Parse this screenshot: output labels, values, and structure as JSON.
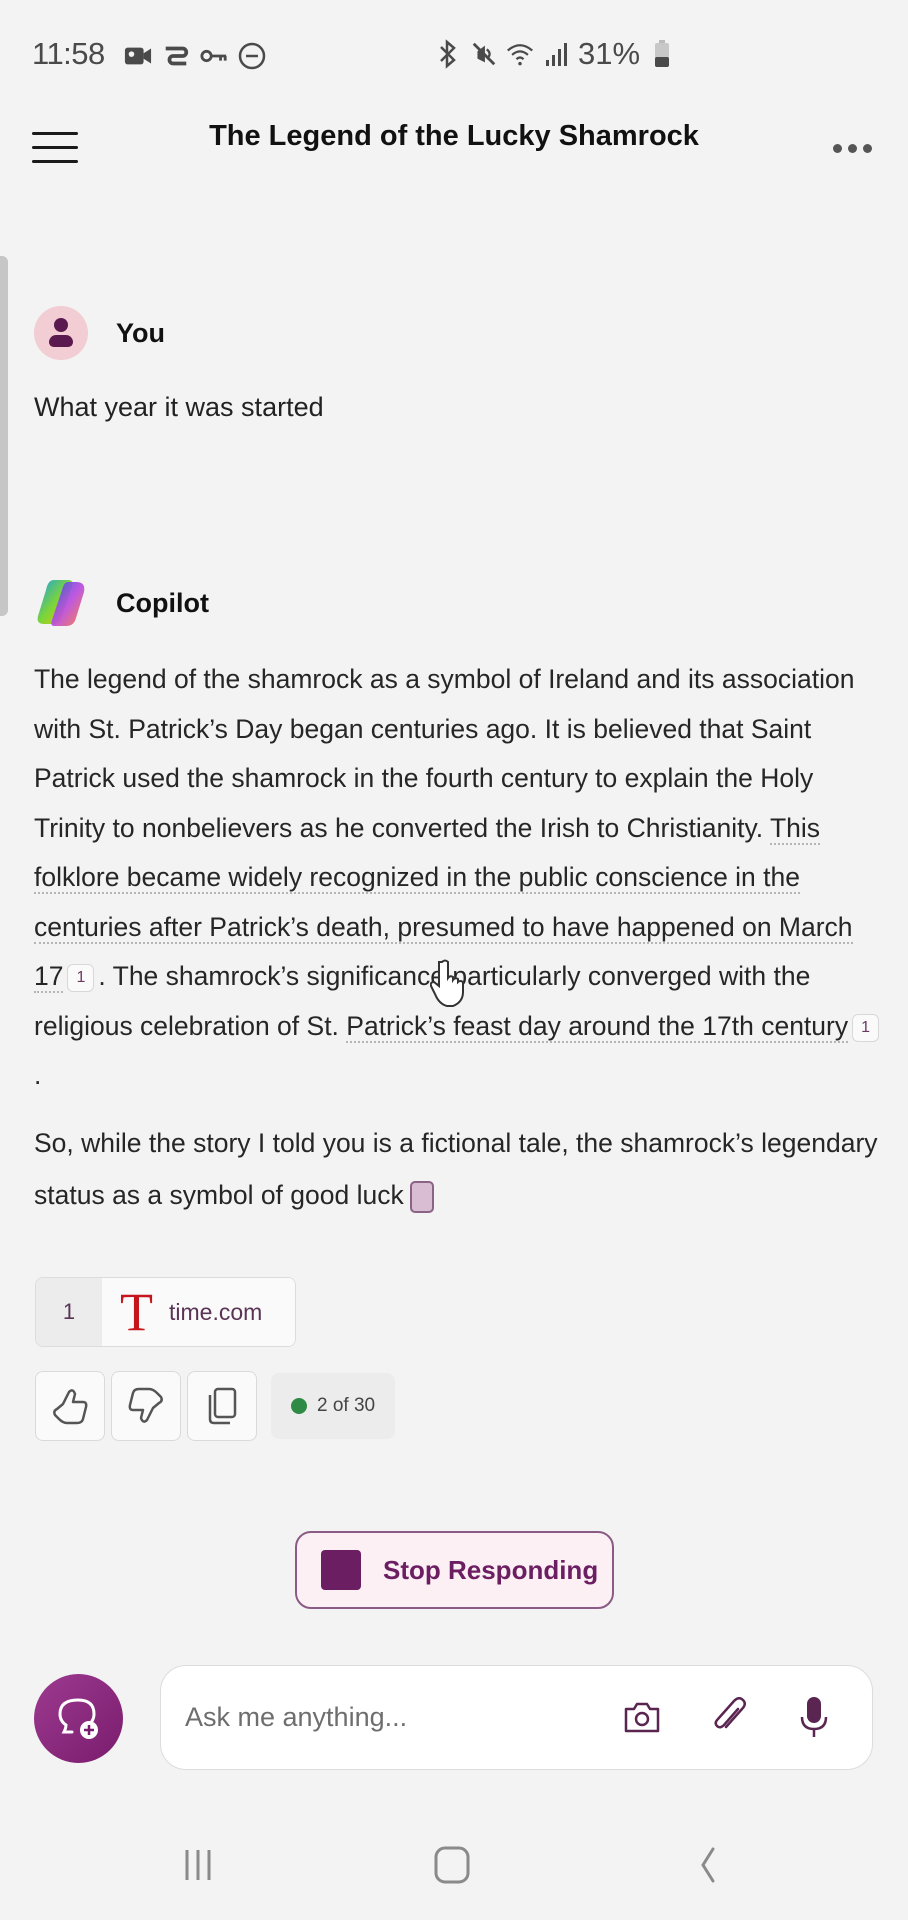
{
  "status_bar": {
    "time": "11:58",
    "left_icons": [
      "video-record-icon",
      "cast-icon",
      "vpn-key-icon",
      "do-not-disturb-icon"
    ],
    "right_icons": [
      "bluetooth-icon",
      "mute-icon",
      "wifi-icon",
      "signal-icon",
      "battery-icon"
    ],
    "battery_percent": "31%"
  },
  "header": {
    "title": "The Legend of the Lucky Shamrock",
    "menu_icon": "hamburger-icon",
    "more_icon": "more-horizontal-icon"
  },
  "conversation": {
    "user_message": {
      "sender": "You",
      "text": "What year it was started"
    },
    "assistant_message": {
      "sender": "Copilot",
      "paragraph1": {
        "plain": "The legend of the shamrock as a symbol of Ireland and its association with St. Patrick’s Day began centuries ago. It is believed that Saint Patrick used the shamrock in the fourth century to explain the Holy Trinity to nonbelievers as he converted the Irish to Christianity. ",
        "cited1": "This folklore became widely recognized in the public conscience in the centuries after Patrick’s death, presumed to have happened on March 17",
        "cite1": "1",
        "mid": ". The shamrock’s significance particularly converged with the religious celebration of St. ",
        "cited2": "Patrick’s feast day around the 17th century",
        "cite2": "1",
        "end": "."
      },
      "paragraph2": "So, while the story I told you is a fictional tale, the shamrock’s legendary status as a symbol of good luck",
      "sources": [
        {
          "number": "1",
          "logo": "T",
          "domain": "time.com"
        }
      ],
      "actions": {
        "like": "thumbs-up-icon",
        "dislike": "thumbs-down-icon",
        "copy": "copy-icon"
      },
      "turn_counter": "2 of 30",
      "turn_status_color": "#2e8b45"
    }
  },
  "stop_button": {
    "label": "Stop Responding"
  },
  "composer": {
    "placeholder": "Ask me anything...",
    "value": "",
    "icons": [
      "camera-icon",
      "paperclip-icon",
      "microphone-icon"
    ],
    "new_chat_icon": "new-chat-icon"
  },
  "nav_bar": {
    "buttons": [
      "recent-apps-icon",
      "home-icon",
      "back-icon"
    ]
  },
  "colors": {
    "accent": "#6c1e62",
    "background": "#f3f3f3",
    "citation_text": "#5a3455",
    "time_logo": "#c4161c"
  }
}
